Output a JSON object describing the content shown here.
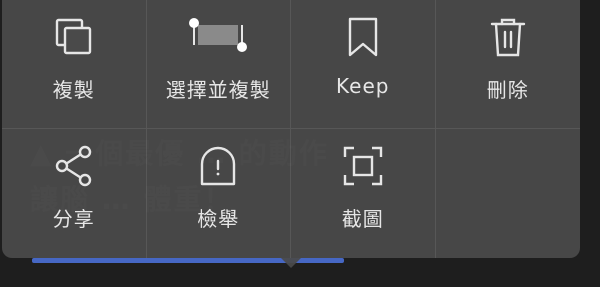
{
  "menu": {
    "items": [
      {
        "label": "複製",
        "icon": "copy-icon"
      },
      {
        "label": "選擇並複製",
        "icon": "select-text-icon"
      },
      {
        "label": "Keep",
        "icon": "bookmark-icon"
      },
      {
        "label": "刪除",
        "icon": "trash-icon"
      },
      {
        "label": "分享",
        "icon": "share-icon"
      },
      {
        "label": "檢舉",
        "icon": "report-icon"
      },
      {
        "label": "截圖",
        "icon": "screenshot-icon"
      }
    ]
  },
  "colors": {
    "menu_background": "#4a4a4a",
    "icon_color": "#e6e6e6",
    "link_underline": "#4a6fd6"
  }
}
